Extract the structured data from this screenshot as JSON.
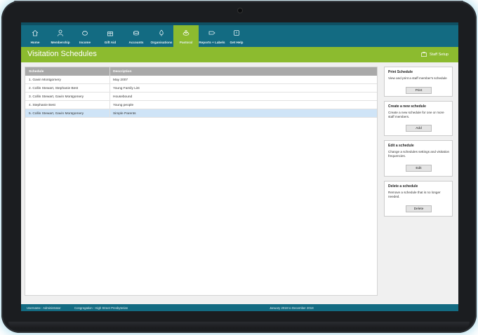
{
  "nav": {
    "items": [
      {
        "label": "Home",
        "icon": "home-icon"
      },
      {
        "label": "Membership",
        "icon": "person-icon"
      },
      {
        "label": "Income",
        "icon": "piggy-bank-icon"
      },
      {
        "label": "Gift Aid",
        "icon": "gift-icon"
      },
      {
        "label": "Accounts",
        "icon": "coins-icon"
      },
      {
        "label": "Organisations",
        "icon": "tree-icon"
      },
      {
        "label": "Pastoral",
        "icon": "hands-icon"
      },
      {
        "label": "Reports + Labels",
        "icon": "label-icon"
      },
      {
        "label": "Get Help",
        "icon": "help-icon"
      }
    ],
    "active": "Pastoral"
  },
  "header": {
    "title": "Visitation Schedules",
    "staff_setup": "Staff Setup"
  },
  "table": {
    "columns": [
      "Schedule",
      "Description"
    ],
    "rows": [
      {
        "schedule": "1. Gavin Montgomery",
        "description": "May 2007"
      },
      {
        "schedule": "2. Collin Stewart, Stephanie Best",
        "description": "Young Family List"
      },
      {
        "schedule": "3. Collin Stewart, Gavin Montgomery",
        "description": "Housebound"
      },
      {
        "schedule": "4. Stephanie Best",
        "description": "Young people"
      },
      {
        "schedule": "5. Collin Stewart, Gavin Montgomery",
        "description": "Simple Parents"
      }
    ],
    "selected_row": 5
  },
  "cards": [
    {
      "title": "Print Schedule",
      "description": "View and print a staff member's schedule",
      "button": "Print"
    },
    {
      "title": "Create a new schedule",
      "description": "Create a new schedule for one or more staff members.",
      "button": "Add"
    },
    {
      "title": "Edit a schedule",
      "description": "Change a schedules settings and visitation frequencies.",
      "button": "Edit"
    },
    {
      "title": "Delete a schedule",
      "description": "Remove a schedule that is no longer needed.",
      "button": "Delete"
    }
  ],
  "status": {
    "username": "Username : Administrator",
    "congregation": "Congregation : High Street Presbyterian",
    "period": "January 2018 to December 2018"
  },
  "colors": {
    "primary_teal": "#136b82",
    "accent_green": "#8cbb2f",
    "selected_row": "#cfe4f7"
  }
}
